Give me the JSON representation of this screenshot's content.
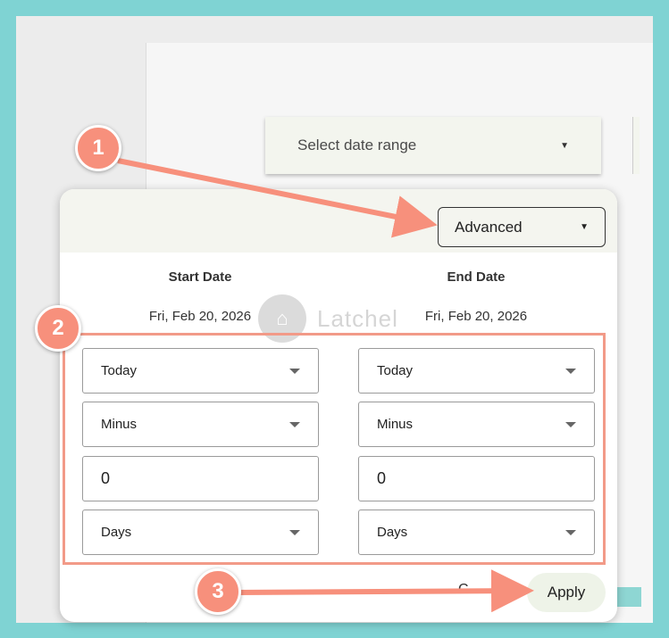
{
  "date_range_select": {
    "label": "Select date range"
  },
  "panel": {
    "mode_label": "Advanced",
    "start": {
      "title": "Start Date",
      "date": "Fri, Feb 20, 2026",
      "anchor": "Today",
      "operator": "Minus",
      "amount": "0",
      "unit": "Days"
    },
    "end": {
      "title": "End Date",
      "date": "Fri, Feb 20, 2026",
      "anchor": "Today",
      "operator": "Minus",
      "amount": "0",
      "unit": "Days"
    },
    "cancel_fragment": "C",
    "apply_label": "Apply"
  },
  "watermark": {
    "text": "Latchel"
  },
  "steps": [
    "1",
    "2",
    "3"
  ],
  "colors": {
    "accent": "#f7907c",
    "highlight_box": "#f29a88",
    "background": "#7fd3d3"
  }
}
